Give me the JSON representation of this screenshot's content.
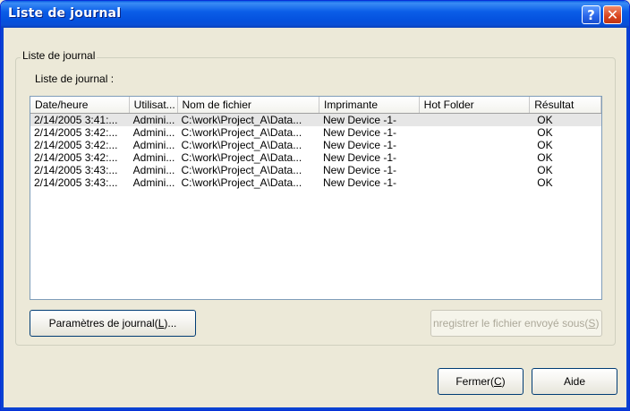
{
  "window": {
    "title": "Liste de journal"
  },
  "group": {
    "legend": "Liste de journal",
    "list_label": "Liste de journal :"
  },
  "table": {
    "columns": [
      "Date/heure",
      "Utilisat...",
      "Nom de fichier",
      "Imprimante",
      "Hot Folder",
      "Résultat"
    ],
    "rows": [
      [
        "2/14/2005 3:41:...",
        "Admini...",
        "C:\\work\\Project_A\\Data...",
        "New Device -1-",
        "",
        "OK"
      ],
      [
        "2/14/2005 3:42:...",
        "Admini...",
        "C:\\work\\Project_A\\Data...",
        "New Device -1-",
        "",
        "OK"
      ],
      [
        "2/14/2005 3:42:...",
        "Admini...",
        "C:\\work\\Project_A\\Data...",
        "New Device -1-",
        "",
        "OK"
      ],
      [
        "2/14/2005 3:42:...",
        "Admini...",
        "C:\\work\\Project_A\\Data...",
        "New Device -1-",
        "",
        "OK"
      ],
      [
        "2/14/2005 3:43:...",
        "Admini...",
        "C:\\work\\Project_A\\Data...",
        "New Device -1-",
        "",
        "OK"
      ],
      [
        "2/14/2005 3:43:...",
        "Admini...",
        "C:\\work\\Project_A\\Data...",
        "New Device -1-",
        "",
        "OK"
      ]
    ]
  },
  "buttons": {
    "log_settings": {
      "text": "Paramètres de journal(",
      "key": "L",
      "suffix": ")..."
    },
    "save_sent": {
      "text": "nregistrer le fichier envoyé sous(",
      "key": "S",
      "suffix": ")"
    },
    "close": {
      "text": "Fermer(",
      "key": "C",
      "suffix": ")"
    },
    "help": "Aide"
  },
  "colors": {
    "title_bar": "#0b5ee8",
    "close_button": "#d9441e",
    "window_bg": "#ece9d8"
  }
}
